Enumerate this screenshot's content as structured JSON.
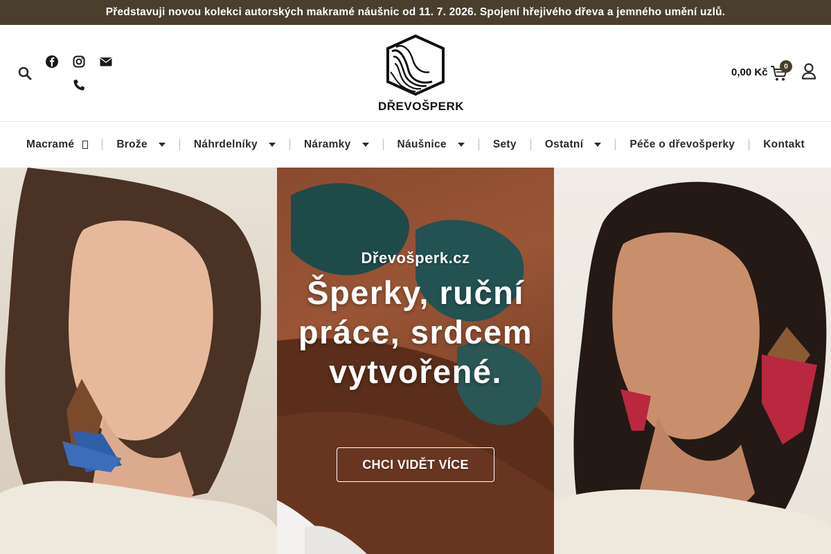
{
  "announcement": "Představuji novou kolekci autorských makramé náušnic od 11. 7. 2026. Spojení hřejivého dřeva a jemného umění uzlů.",
  "header": {
    "logo_text": "DŘEVOŠPERK",
    "cart_price": "0,00 Kč",
    "cart_count": "0",
    "icons": [
      "search-icon",
      "facebook-icon",
      "instagram-icon",
      "envelope-icon",
      "phone-icon",
      "cart-icon",
      "user-icon"
    ]
  },
  "nav": {
    "items": [
      {
        "label": "Macramé",
        "dropdown": false
      },
      {
        "label": "Brože",
        "dropdown": true
      },
      {
        "label": "Náhrdelníky",
        "dropdown": true
      },
      {
        "label": "Náramky",
        "dropdown": true
      },
      {
        "label": "Náušnice",
        "dropdown": true
      },
      {
        "label": "Sety",
        "dropdown": false
      },
      {
        "label": "Ostatní",
        "dropdown": true
      },
      {
        "label": "Péče o dřevošperky",
        "dropdown": false
      },
      {
        "label": "Kontakt",
        "dropdown": false
      }
    ]
  },
  "hero": {
    "site": "Dřevošperk.cz",
    "title": "Šperky, ruční práce, srdcem vytvořené.",
    "button": "CHCI VIDĚT VÍCE"
  },
  "colors": {
    "topbar": "#4a3f2c",
    "text": "#2b2b2b",
    "white": "#ffffff"
  }
}
